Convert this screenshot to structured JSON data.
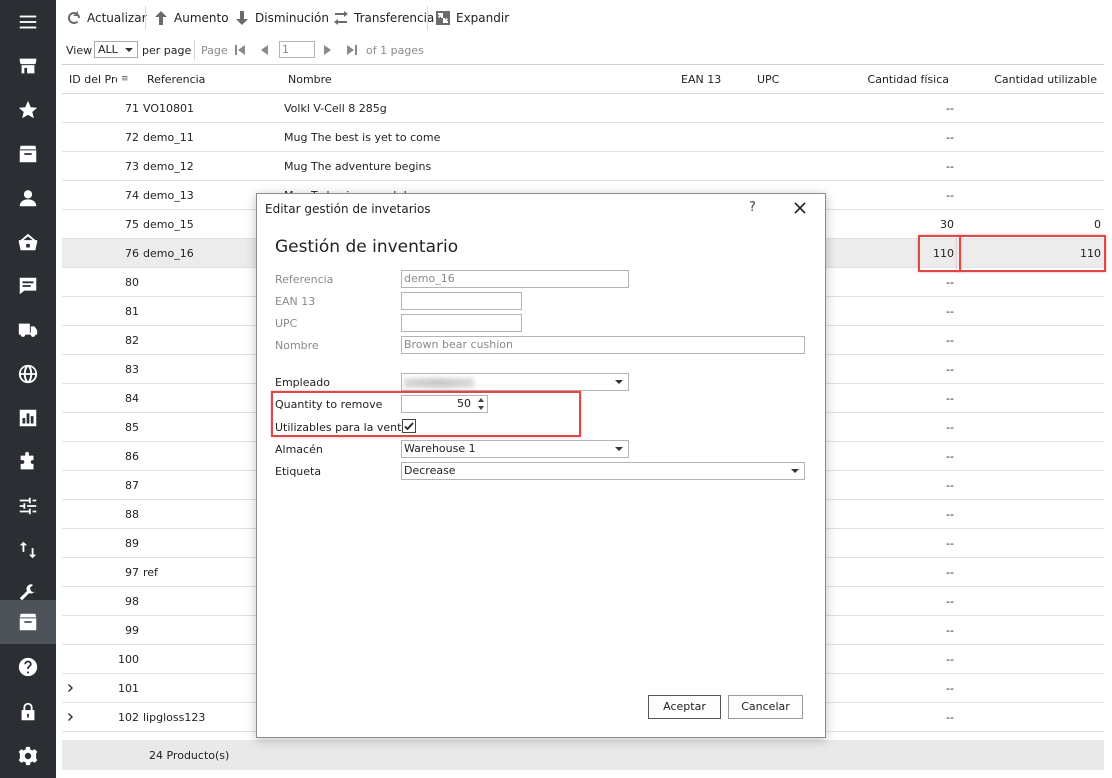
{
  "toolbar": {
    "refresh": "Actualizar",
    "increase": "Aumento",
    "decrease": "Disminución",
    "transfer": "Transferencia",
    "expand": "Expandir"
  },
  "pager": {
    "view_label": "View",
    "view_value": "ALL",
    "per_page": "per page",
    "page_label": "Page",
    "page_value": "1",
    "of_pages": "of 1 pages"
  },
  "grid": {
    "headers": {
      "id": "ID del Pro",
      "ref": "Referencia",
      "name": "Nombre",
      "ean": "EAN 13",
      "upc": "UPC",
      "phys": "Cantidad física",
      "usable": "Cantidad utilizable"
    },
    "rows": [
      {
        "id": "71",
        "ref": "VO10801",
        "name": "Volkl V-Cell 8 285g",
        "phys": "--",
        "usable": ""
      },
      {
        "id": "72",
        "ref": "demo_11",
        "name": "Mug The best is yet to come",
        "phys": "--",
        "usable": ""
      },
      {
        "id": "73",
        "ref": "demo_12",
        "name": "Mug The adventure begins",
        "phys": "--",
        "usable": ""
      },
      {
        "id": "74",
        "ref": "demo_13",
        "name": "Mug Today is a good day",
        "phys": "--",
        "usable": ""
      },
      {
        "id": "75",
        "ref": "demo_15",
        "name": "",
        "phys": "30",
        "usable": "0"
      },
      {
        "id": "76",
        "ref": "demo_16",
        "name": "",
        "phys": "110",
        "usable": "110"
      },
      {
        "id": "80",
        "ref": "",
        "name": "",
        "phys": "--",
        "usable": ""
      },
      {
        "id": "81",
        "ref": "",
        "name": "",
        "phys": "--",
        "usable": ""
      },
      {
        "id": "82",
        "ref": "",
        "name": "",
        "phys": "--",
        "usable": ""
      },
      {
        "id": "83",
        "ref": "",
        "name": "",
        "phys": "--",
        "usable": ""
      },
      {
        "id": "84",
        "ref": "",
        "name": "",
        "phys": "--",
        "usable": ""
      },
      {
        "id": "85",
        "ref": "",
        "name": "",
        "phys": "--",
        "usable": ""
      },
      {
        "id": "86",
        "ref": "",
        "name": "",
        "phys": "--",
        "usable": ""
      },
      {
        "id": "87",
        "ref": "",
        "name": "",
        "phys": "--",
        "usable": ""
      },
      {
        "id": "88",
        "ref": "",
        "name": "",
        "phys": "--",
        "usable": ""
      },
      {
        "id": "89",
        "ref": "",
        "name": "",
        "phys": "--",
        "usable": ""
      },
      {
        "id": "97",
        "ref": "ref",
        "name": "",
        "phys": "--",
        "usable": ""
      },
      {
        "id": "98",
        "ref": "",
        "name": "",
        "phys": "--",
        "usable": ""
      },
      {
        "id": "99",
        "ref": "",
        "name": "",
        "phys": "--",
        "usable": ""
      },
      {
        "id": "100",
        "ref": "",
        "name": "",
        "phys": "--",
        "usable": ""
      },
      {
        "id": "101",
        "ref": "",
        "name": "",
        "phys": "--",
        "usable": ""
      },
      {
        "id": "102",
        "ref": "lipgloss123",
        "name": "",
        "phys": "--",
        "usable": ""
      }
    ],
    "footer": "24 Producto(s)"
  },
  "dialog": {
    "title": "Editar gestión de invetarios",
    "help": "?",
    "heading": "Gestión de inventario",
    "labels": {
      "reference": "Referencia",
      "ean": "EAN 13",
      "upc": "UPC",
      "name": "Nombre",
      "employee": "Empleado",
      "qty": "Quantity to remove",
      "usable": "Utilizables para la venta",
      "warehouse": "Almacén",
      "tag": "Etiqueta"
    },
    "values": {
      "reference": "demo_16",
      "ean": "",
      "upc": "",
      "name": "Brown bear cushion",
      "qty": "50",
      "warehouse": "Warehouse 1",
      "tag": "Decrease"
    },
    "accept": "Aceptar",
    "cancel": "Cancelar"
  },
  "colors": {
    "sidebar": "#2b2f33",
    "highlight": "#e04848"
  }
}
